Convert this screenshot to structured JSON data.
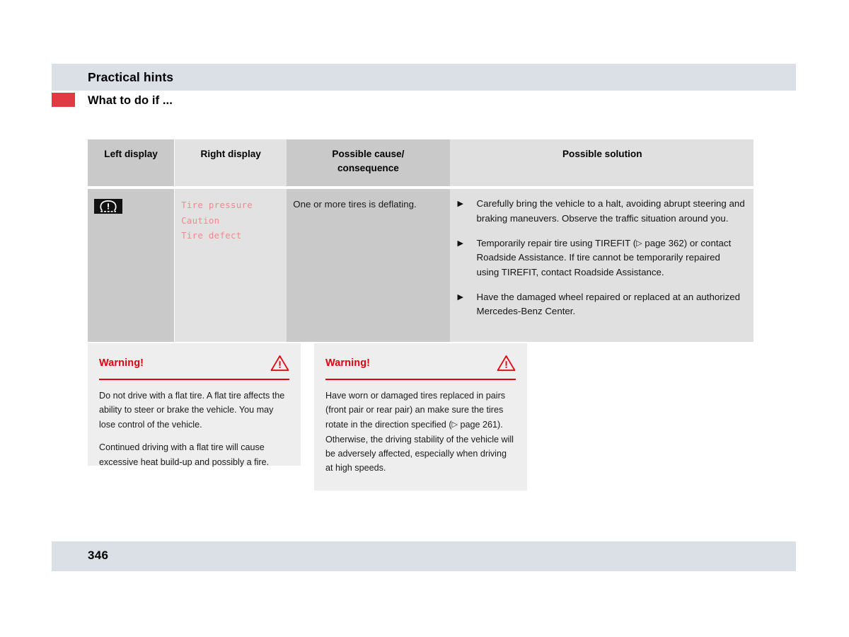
{
  "header": {
    "chapter_title": "Practical hints",
    "section_title": "What to do if ...",
    "marker_color": "#e03a42",
    "band_color": "#dbe0e6"
  },
  "table": {
    "columns": [
      {
        "key": "left_display",
        "label": "Left display"
      },
      {
        "key": "right_display",
        "label": "Right display"
      },
      {
        "key": "cause",
        "label": "Possible cause/\nconsequence"
      },
      {
        "key": "solution",
        "label": "Possible solution"
      }
    ],
    "header_labels": {
      "left_display": "Left display",
      "right_display": "Right display",
      "cause_line1": "Possible cause/",
      "cause_line2": "consequence",
      "solution": "Possible solution"
    },
    "rows": [
      {
        "left_display_icon": "tire-pressure-warning-lamp-icon",
        "right_display_lines": [
          "Tire pressure",
          "Caution",
          "Tire defect"
        ],
        "right_display_color": "#f08a8e",
        "cause": "One or more tires is deflating.",
        "solutions": [
          {
            "bullet": "▶",
            "text": "Carefully bring the vehicle to a halt, avoiding abrupt steering and braking maneuvers. Observe the traffic situation around you."
          },
          {
            "bullet": "▶",
            "text_before_ref": "Temporarily repair tire using TIREFIT (",
            "ref_symbol": "▷",
            "ref_text": " page 362",
            "text_after_ref": ") or contact Roadside Assistance. If tire cannot be temporarily repaired using TIREFIT, contact Roadside Assistance."
          },
          {
            "bullet": "▶",
            "text": "Have the damaged wheel repaired or replaced at an authorized Mercedes-Benz Center."
          }
        ]
      }
    ],
    "shades": {
      "column_dark": "#c9c9c9",
      "column_light": "#e2e2e2"
    }
  },
  "warning_boxes": [
    {
      "title": "Warning!",
      "icon": "warning-triangle-icon",
      "accent_color": "#e3000f",
      "paragraphs": [
        "Do not drive with a flat tire. A flat tire affects the ability to steer or brake the vehicle. You may lose control of the vehicle.",
        "Continued driving with a flat tire will cause excessive heat build-up and possibly a fire."
      ]
    },
    {
      "title": "Warning!",
      "icon": "warning-triangle-icon",
      "accent_color": "#e3000f",
      "paragraphs_rich": {
        "before_ref": "Have worn or damaged tires replaced in pairs (front pair or rear pair) an make sure the tires rotate in the direction specified (",
        "ref_symbol": "▷",
        "ref_text": " page 261",
        "after_ref": "). Otherwise, the driving stability of the vehicle will be adversely affected, especially when driving at high speeds."
      }
    }
  ],
  "footer": {
    "page_number": "346",
    "band_color": "#dbe0e6"
  }
}
